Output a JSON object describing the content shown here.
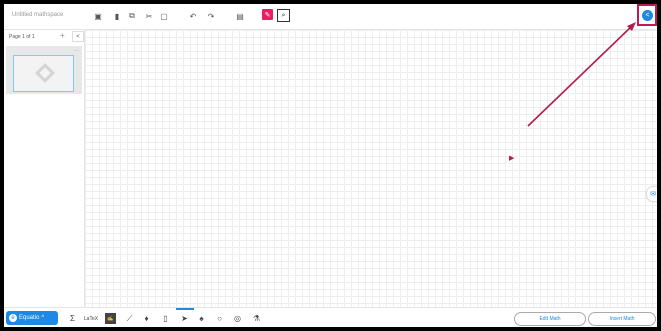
{
  "app": {
    "title": "Untitled mathspace"
  },
  "toolbar": {
    "icons": [
      "save-icon",
      "delete-icon",
      "copy-icon",
      "cut-icon",
      "paste-icon",
      "undo-icon",
      "redo-icon",
      "format-icon",
      "select-pen-icon",
      "select-tool-icon",
      "share-icon"
    ],
    "accent_color": "#e91e63",
    "share_color": "#1e88e5",
    "highlight_color": "#c2185b"
  },
  "sidebar": {
    "page_label": "Page 1 of 1",
    "add_label": "+",
    "collapse_label": "<",
    "thumb_menu": "..."
  },
  "bottom": {
    "brand_label": "Equatio",
    "brand_chevron": "^",
    "latex_label": "LaTeX",
    "edit_math_label": "Edit Math",
    "insert_math_label": "Insert Math",
    "tools": [
      "math-editor-icon",
      "latex-icon",
      "handwriting-icon",
      "graph-icon",
      "speech-input-icon",
      "mobile-icon",
      "pointer-icon",
      "pen-icon",
      "shape-icon",
      "compass-icon",
      "flask-icon"
    ]
  }
}
